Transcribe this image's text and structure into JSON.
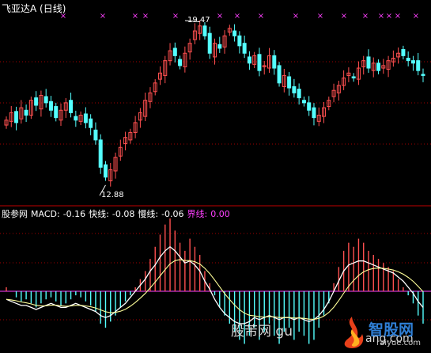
{
  "header": {
    "stock_name": "飞亚达A",
    "period": "(日线)"
  },
  "annotations": {
    "high_price": "19.47",
    "low_price": "12.88"
  },
  "macd_panel": {
    "indicator_source": "股参网",
    "macd_label": "MACD:",
    "macd_value": "-0.16",
    "fast_label": "快线:",
    "fast_value": "-0.08",
    "slow_label": "慢线:",
    "slow_value": "-0.06",
    "zero_label": "界线:",
    "zero_value": "0.00"
  },
  "watermark": {
    "site_left": "股芾网",
    "site_mid": "gu",
    "site_right": "ang.com",
    "logo_name": "智股网",
    "logo_url": "raiyue.com"
  },
  "colors": {
    "up": "#ff5050",
    "down": "#54ffff",
    "marker": "#ff40ff",
    "dotted": "#a00000",
    "separator": "#c00000",
    "zero_line": "#ff40ff",
    "dif_line": "#ffffff",
    "dea_line": "#ffff99"
  },
  "markers": {
    "symbol": "×"
  },
  "chart_data": {
    "type": "candlestick",
    "price_range": [
      12.3,
      19.9
    ],
    "high": 19.47,
    "low": 12.88,
    "close_path": [
      15.5,
      15.8,
      15.4,
      16.0,
      15.7,
      16.3,
      16.1,
      16.5,
      16.2,
      15.9,
      15.6,
      15.9,
      16.2,
      15.8,
      15.5,
      15.7,
      15.4,
      15.2,
      14.7,
      13.6,
      13.2,
      13.5,
      14.0,
      14.4,
      14.8,
      15.0,
      15.4,
      15.8,
      16.3,
      16.6,
      17.0,
      17.4,
      17.9,
      18.3,
      18.1,
      17.7,
      18.2,
      18.6,
      19.1,
      19.3,
      18.9,
      18.2,
      18.6,
      18.4,
      18.9,
      19.2,
      18.9,
      18.5,
      18.2,
      17.8,
      18.1,
      17.5,
      17.7,
      18.1,
      17.6,
      17.0,
      17.3,
      16.8,
      16.6,
      16.4,
      16.2,
      15.9,
      15.6,
      15.7,
      16.0,
      16.3,
      16.7,
      16.9,
      17.2,
      17.4,
      17.2,
      17.6,
      17.9,
      17.6,
      17.8,
      17.5,
      17.7,
      17.9,
      18.0,
      18.2,
      18.1,
      17.9,
      17.8,
      17.5,
      17.3
    ],
    "macd_histogram": [
      0.02,
      0.0,
      -0.03,
      -0.05,
      -0.04,
      -0.06,
      -0.08,
      -0.06,
      -0.04,
      -0.03,
      -0.05,
      -0.07,
      -0.06,
      -0.04,
      -0.02,
      -0.03,
      -0.05,
      -0.07,
      -0.1,
      -0.16,
      -0.18,
      -0.15,
      -0.12,
      -0.08,
      -0.05,
      -0.02,
      0.02,
      0.06,
      0.1,
      0.16,
      0.22,
      0.28,
      0.33,
      0.36,
      0.3,
      0.24,
      0.2,
      0.26,
      0.22,
      0.18,
      0.1,
      0.04,
      -0.02,
      -0.08,
      -0.12,
      -0.16,
      -0.2,
      -0.24,
      -0.26,
      -0.22,
      -0.18,
      -0.24,
      -0.2,
      -0.16,
      -0.22,
      -0.26,
      -0.2,
      -0.18,
      -0.24,
      -0.2,
      -0.22,
      -0.26,
      -0.24,
      -0.18,
      -0.12,
      -0.06,
      0.04,
      0.12,
      0.2,
      0.24,
      0.22,
      0.26,
      0.24,
      0.2,
      0.18,
      0.16,
      0.14,
      0.12,
      0.1,
      0.06,
      0.02,
      -0.02,
      -0.06,
      -0.12,
      -0.16
    ],
    "dif": [
      -0.04,
      -0.05,
      -0.06,
      -0.07,
      -0.07,
      -0.08,
      -0.09,
      -0.08,
      -0.07,
      -0.06,
      -0.07,
      -0.08,
      -0.08,
      -0.07,
      -0.06,
      -0.07,
      -0.08,
      -0.09,
      -0.1,
      -0.12,
      -0.13,
      -0.12,
      -0.1,
      -0.08,
      -0.06,
      -0.03,
      0.0,
      0.03,
      0.06,
      0.1,
      0.13,
      0.17,
      0.2,
      0.22,
      0.2,
      0.17,
      0.14,
      0.15,
      0.13,
      0.1,
      0.05,
      0.01,
      -0.04,
      -0.08,
      -0.11,
      -0.13,
      -0.15,
      -0.16,
      -0.16,
      -0.15,
      -0.13,
      -0.14,
      -0.13,
      -0.12,
      -0.13,
      -0.14,
      -0.13,
      -0.13,
      -0.14,
      -0.13,
      -0.14,
      -0.15,
      -0.14,
      -0.12,
      -0.09,
      -0.05,
      0.0,
      0.05,
      0.1,
      0.13,
      0.14,
      0.15,
      0.15,
      0.14,
      0.13,
      0.12,
      0.11,
      0.1,
      0.09,
      0.07,
      0.05,
      0.02,
      -0.01,
      -0.05,
      -0.08
    ]
  }
}
